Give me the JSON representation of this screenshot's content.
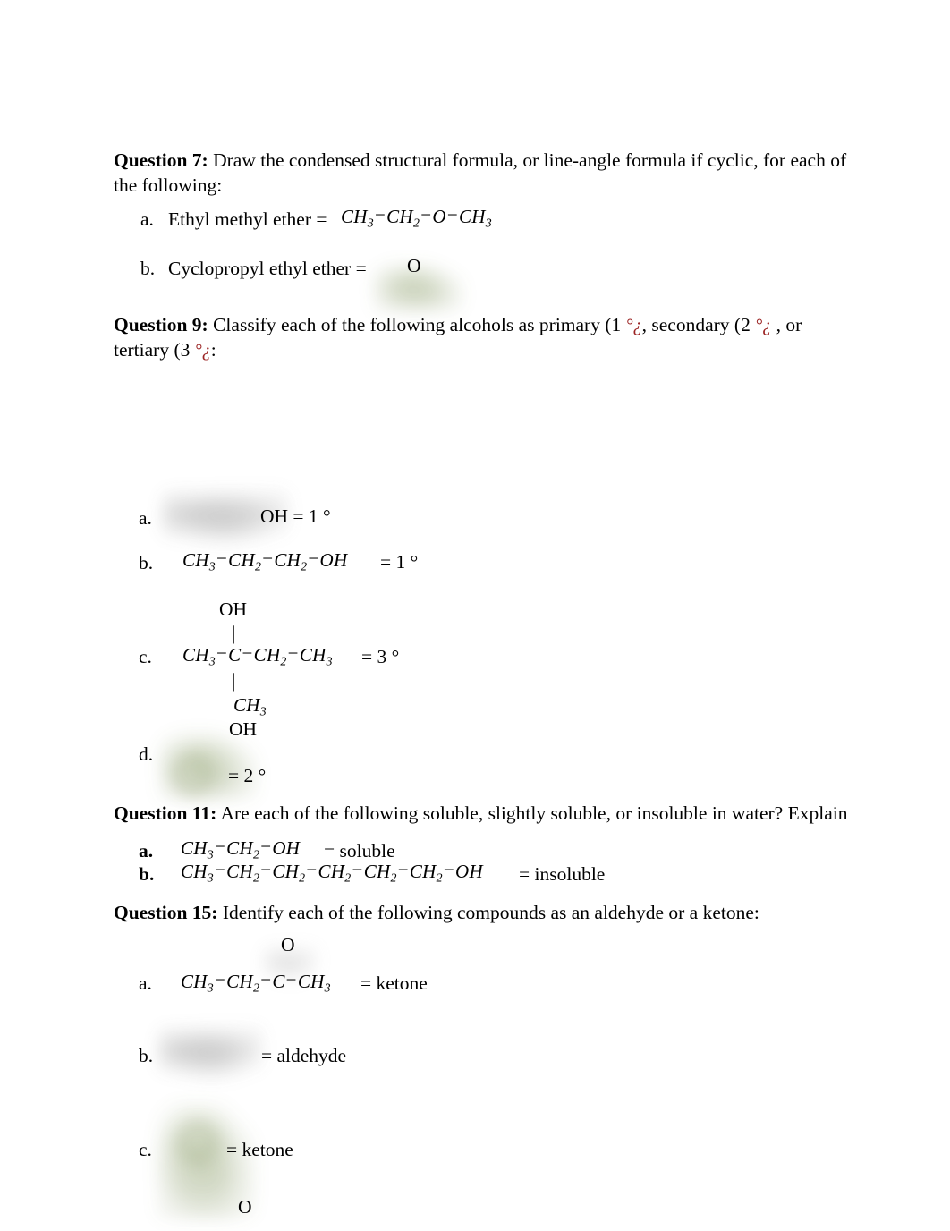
{
  "document": {
    "type": "chemistry-worksheet",
    "page_background": "#ffffff",
    "text_color": "#000000",
    "accent_error_color": "#9b2323"
  },
  "q7": {
    "label": "Question 7:",
    "prompt_line1": " Draw the condensed structural formula, or line-angle formula if cyclic, for each of",
    "prompt_line2": "the following:",
    "items": [
      {
        "marker": "a.",
        "text": "Ethyl methyl ether =",
        "formula": "CH3−CH2−O−CH3"
      },
      {
        "marker": "b.",
        "text": "Cyclopropyl ethyl ether =",
        "formula": "O"
      }
    ]
  },
  "q9": {
    "label": "Question 9:",
    "prompt_part1": " Classify each of the following alcohols as primary (1 ",
    "prompt_sym1": "°¿",
    "prompt_part2": ",   secondary (2 ",
    "prompt_sym2": "°¿",
    "prompt_part3": " , or",
    "prompt_line2_part1": "tertiary (3 ",
    "prompt_sym3": "°¿",
    "prompt_line2_part2": ":",
    "items": [
      {
        "marker": "a.",
        "tail": "OH = 1 °",
        "note": "structure image missing"
      },
      {
        "marker": "b.",
        "formula": "CH3−CH2−CH2−OH",
        "tail": "= 1 °"
      },
      {
        "marker": "c.",
        "top_group": "OH",
        "chain": "CH3−C−CH2−CH3",
        "bottom_group": "CH3",
        "tail": "= 3 °"
      },
      {
        "marker": "d.",
        "top_group": "OH",
        "tail": "= 2 °",
        "note": "structure image missing"
      }
    ]
  },
  "q11": {
    "label": "Question 11:",
    "prompt": " Are each of the following soluble, slightly soluble, or insoluble in water? Explain",
    "items": [
      {
        "marker": "a.",
        "formula": "CH3−CH2−OH",
        "answer": "= soluble"
      },
      {
        "marker": "b.",
        "formula": "CH3−CH2−CH2−CH2−CH2−CH2−OH",
        "answer": "= insoluble"
      }
    ]
  },
  "q15": {
    "label": "Question 15:",
    "prompt": "  Identify each of the following compounds as an aldehyde or a ketone:",
    "items": [
      {
        "marker": "a.",
        "top_group": "O",
        "formula": "CH3−CH2−C−CH3",
        "answer": "= ketone"
      },
      {
        "marker": "b.",
        "answer": "= aldehyde",
        "note": "structure image missing"
      },
      {
        "marker": "c.",
        "answer": "= ketone",
        "note": "structure image missing"
      },
      {
        "marker": "",
        "top_group": "O",
        "note": "start of next structure, cut off at page bottom"
      }
    ]
  },
  "formula_parts": {
    "ch": "CH",
    "sub3": "3",
    "sub2": "2",
    "bond": "−",
    "o": "O",
    "c": "C",
    "oh": "OH",
    "vbar": "|",
    "degree": "°"
  }
}
